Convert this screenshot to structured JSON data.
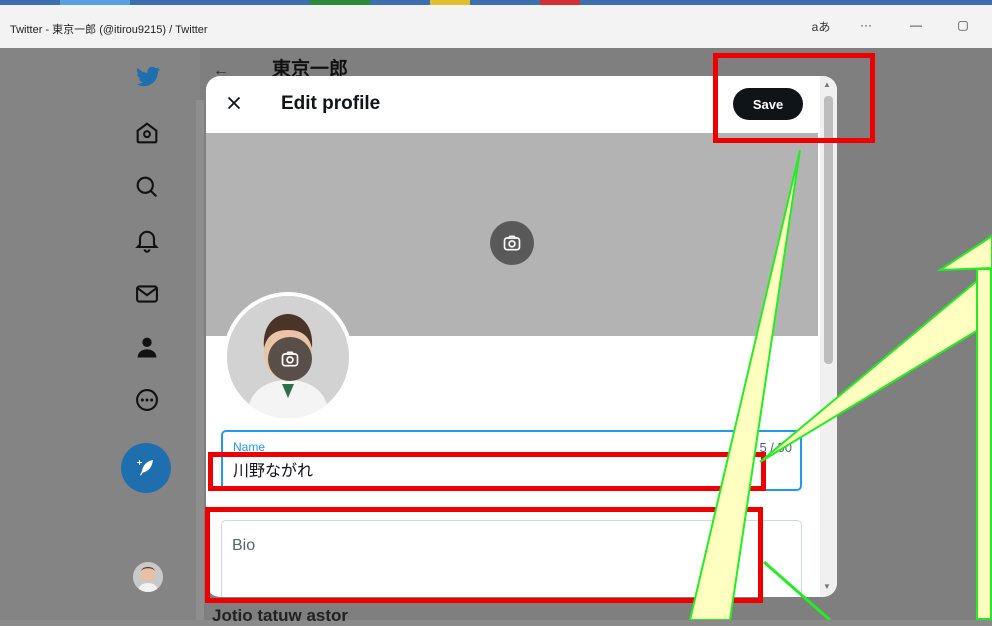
{
  "window": {
    "title": "Twitter - 東京一郎 (@itirou9215) / Twitter",
    "controls": {
      "read_aloud": "aあ",
      "more": "···",
      "minimize": "—",
      "maximize": "▢"
    }
  },
  "page": {
    "title": "東京一郎",
    "behind_text": "Jotio tatuw astor"
  },
  "modal": {
    "title": "Edit profile",
    "save_label": "Save",
    "name_field": {
      "label": "Name",
      "value": "川野ながれ",
      "counter": "5 / 50"
    },
    "bio_field": {
      "placeholder": "Bio"
    }
  },
  "colors": {
    "twitter_blue": "#1d9bf0",
    "annotation_red": "#ee0000",
    "callout_green": "#22ee22",
    "callout_fill": "#ffffc0"
  },
  "icons": {
    "sidebar": [
      "twitter-bird-icon",
      "home-icon",
      "search-icon",
      "bell-icon",
      "mail-icon",
      "profile-icon",
      "more-circle-icon"
    ]
  }
}
